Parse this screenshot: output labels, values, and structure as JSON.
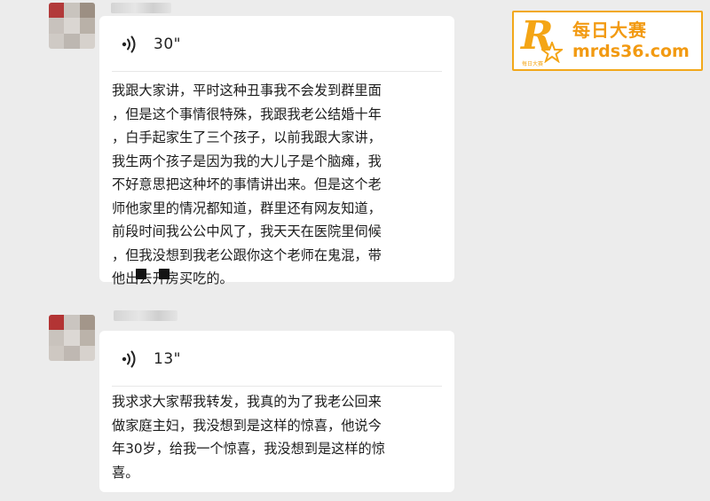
{
  "watermark": {
    "name_cn": "每日大赛",
    "url": "mrds36.com",
    "badge_letter": "R",
    "badge_small": "每日大赛",
    "brand_color": "#f29a12"
  },
  "messages": [
    {
      "type": "voice+text",
      "voice_duration": "30\"",
      "text": "我跟大家讲，平时这种丑事我不会发到群里面\n，但是这个事情很特殊，我跟我老公结婚十年\n，白手起家生了三个孩子，以前我跟大家讲，\n我生两个孩子是因为我的大儿子是个脑瘫，我\n不好意思把这种坏的事情讲出来。但是这个老\n师他家里的情况都知道，群里还有网友知道，\n前段时间我公公中风了，我天天在医院里伺候\n，但我没想到我老公跟你这个老师在鬼混，带\n他出去开房买吃的。"
    },
    {
      "type": "voice+text",
      "voice_duration": "13\"",
      "text": "我求求大家帮我转发，我真的为了我老公回来\n做家庭主妇，我没想到是这样的惊喜，他说今\n年30岁，给我一个惊喜，我没想到是这样的惊\n喜。"
    }
  ],
  "icons": [
    "voice-wave-icon",
    "star-icon"
  ]
}
